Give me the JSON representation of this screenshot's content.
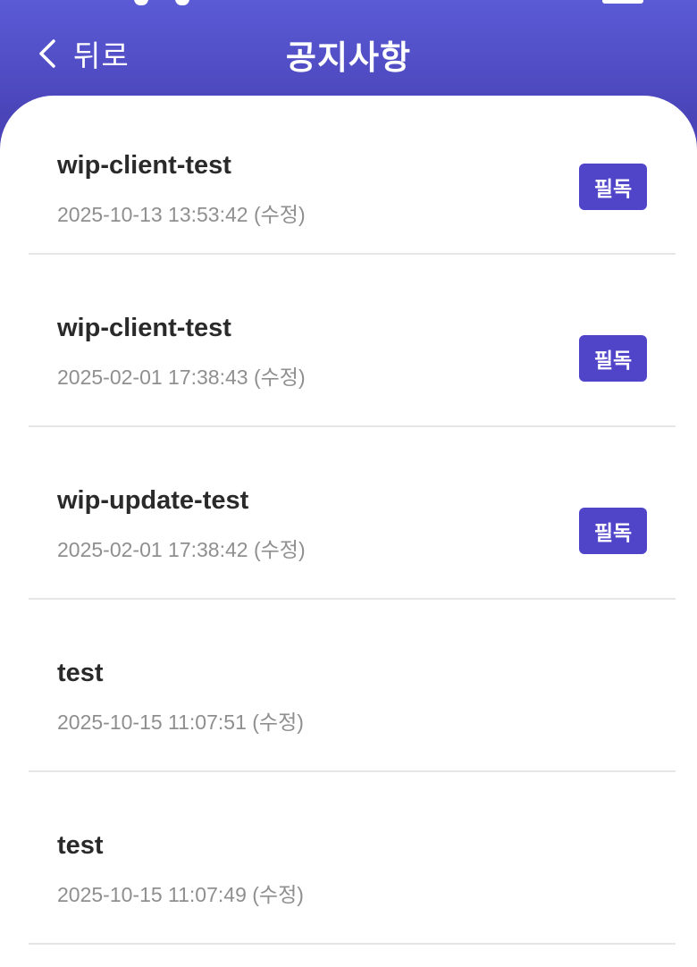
{
  "header": {
    "back_label": "뒤로",
    "title": "공지사항"
  },
  "notices": [
    {
      "title": "wip-client-test",
      "date": "2025-10-13 13:53:42 (수정)",
      "badge": "필독"
    },
    {
      "title": "wip-client-test",
      "date": "2025-02-01 17:38:43 (수정)",
      "badge": "필독"
    },
    {
      "title": "wip-update-test",
      "date": "2025-02-01 17:38:42 (수정)",
      "badge": "필독"
    },
    {
      "title": "test",
      "date": "2025-10-15 11:07:51 (수정)",
      "badge": ""
    },
    {
      "title": "test",
      "date": "2025-10-15 11:07:49 (수정)",
      "badge": ""
    }
  ],
  "colors": {
    "header_bg": "#5b5bd6",
    "badge_bg": "#5044c9",
    "title_text": "#2a2a2a",
    "date_text": "#8f8f8f",
    "divider": "#e6e6e6"
  },
  "icons": {
    "back": "chevron-left-icon"
  }
}
